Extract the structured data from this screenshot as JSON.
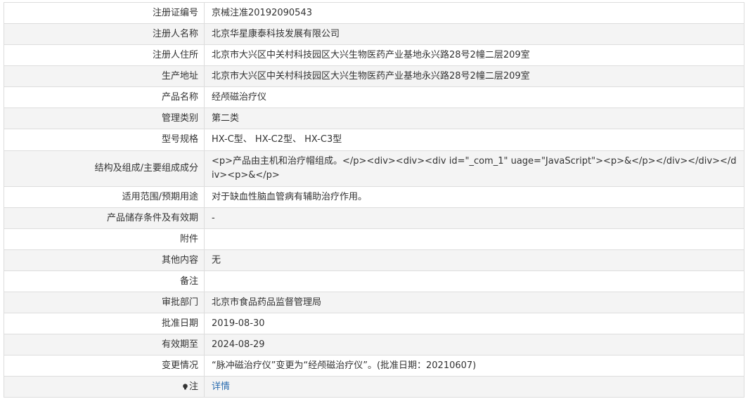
{
  "rows": [
    {
      "label": "注册证编号",
      "value": "京械注准20192090543"
    },
    {
      "label": "注册人名称",
      "value": "北京华星康泰科技发展有限公司"
    },
    {
      "label": "注册人住所",
      "value": "北京市大兴区中关村科技园区大兴生物医药产业基地永兴路28号2幢二层209室"
    },
    {
      "label": "生产地址",
      "value": "北京市大兴区中关村科技园区大兴生物医药产业基地永兴路28号2幢二层209室"
    },
    {
      "label": "产品名称",
      "value": "经颅磁治疗仪"
    },
    {
      "label": "管理类别",
      "value": "第二类"
    },
    {
      "label": "型号规格",
      "value": "HX-C型、 HX-C2型、 HX-C3型"
    },
    {
      "label": "结构及组成/主要组成成分",
      "value": "<p>产品由主机和治疗帽组成。</p><div><div><div id=\"_com_1\" uage=\"JavaScript\"><p>&</p></div></div></div><p>&</p>"
    },
    {
      "label": "适用范围/预期用途",
      "value": "对于缺血性脑血管病有辅助治疗作用。"
    },
    {
      "label": "产品储存条件及有效期",
      "value": "-"
    },
    {
      "label": "附件",
      "value": ""
    },
    {
      "label": "其他内容",
      "value": "无"
    },
    {
      "label": "备注",
      "value": ""
    },
    {
      "label": "审批部门",
      "value": "北京市食品药品监督管理局"
    },
    {
      "label": "批准日期",
      "value": "2019-08-30"
    },
    {
      "label": "有效期至",
      "value": "2024-08-29"
    },
    {
      "label": "变更情况",
      "value": "“脉冲磁治疗仪”变更为“经颅磁治疗仪”。(批准日期：20210607)"
    }
  ],
  "note_row": {
    "label": "注",
    "link_text": "详情",
    "icon": "lightbulb-icon"
  },
  "colors": {
    "border": "#dddddd",
    "row_alt": "#f4f4f4",
    "link": "#2a6cb0",
    "text": "#333333"
  }
}
